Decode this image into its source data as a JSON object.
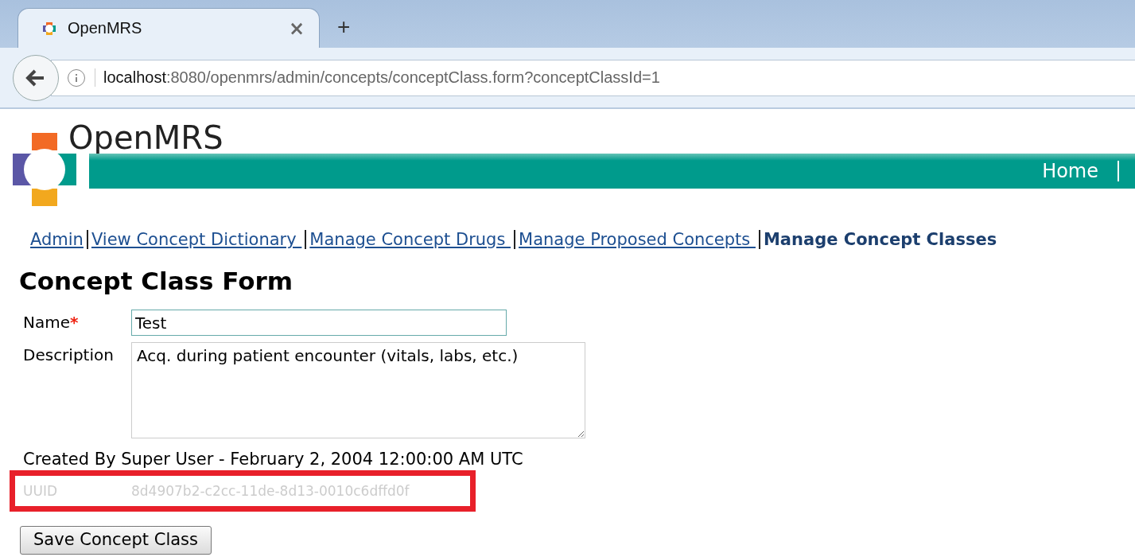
{
  "browser": {
    "tab": {
      "title": "OpenMRS",
      "close": "×"
    },
    "new_tab": "+",
    "address": {
      "host": "localhost",
      "path": ":8080/openmrs/admin/concepts/conceptClass.form?conceptClassId=1"
    }
  },
  "header": {
    "logo_text": "OpenMRS",
    "nav": [
      {
        "label": "Home"
      }
    ]
  },
  "breadcrumbs": [
    {
      "label": "Admin",
      "selected": false
    },
    {
      "label": "View Concept Dictionary ",
      "selected": false
    },
    {
      "label": "Manage Concept Drugs ",
      "selected": false
    },
    {
      "label": "Manage Proposed Concepts ",
      "selected": false
    },
    {
      "label": "Manage Concept Classes",
      "selected": true
    }
  ],
  "title": "Concept Class Form",
  "form": {
    "name": {
      "label": "Name",
      "required_mark": "*",
      "value": "Test"
    },
    "description": {
      "label": "Description",
      "value": "Acq. during patient encounter (vitals, labs, etc.)"
    },
    "created_by": "Created By Super User - February 2, 2004 12:00:00 AM UTC",
    "uuid": {
      "label": "UUID",
      "value": "8d4907b2-c2cc-11de-8d13-0010c6dffd0f",
      "highlighted": true
    },
    "submit": "Save Concept Class"
  }
}
